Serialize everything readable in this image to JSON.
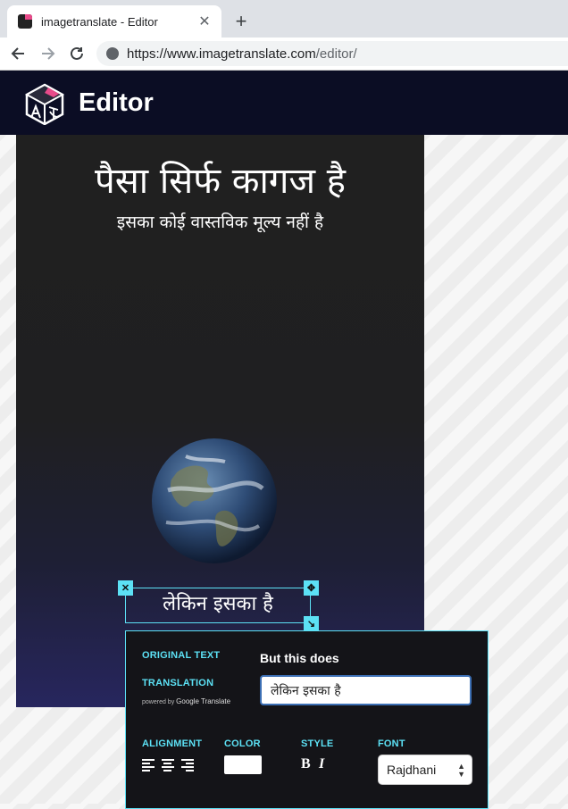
{
  "browser": {
    "tab_title": "imagetranslate - Editor",
    "tab_close": "✕",
    "new_tab": "+",
    "url_host": "https://www.imagetranslate.com",
    "url_path": "/editor/"
  },
  "app": {
    "title": "Editor"
  },
  "canvas": {
    "headline": "पैसा सिर्फ कागज है",
    "subline": "इसका कोई वास्तविक मूल्य नहीं है",
    "selected_text": "लेकिन इसका है"
  },
  "panel": {
    "original_label": "ORIGINAL TEXT",
    "original_value": "But this does",
    "translation_label": "TRANSLATION",
    "powered_by": "powered by",
    "google_translate": "Google Translate",
    "translation_value": "लेकिन इसका है",
    "alignment_label": "ALIGNMENT",
    "color_label": "COLOR",
    "style_label": "STYLE",
    "font_label": "FONT",
    "bold": "B",
    "italic": "I",
    "font_value": "Rajdhani",
    "text_color": "#ffffff"
  },
  "colors": {
    "accent": "#5ce1f5",
    "header_bg": "#0b0d24"
  }
}
